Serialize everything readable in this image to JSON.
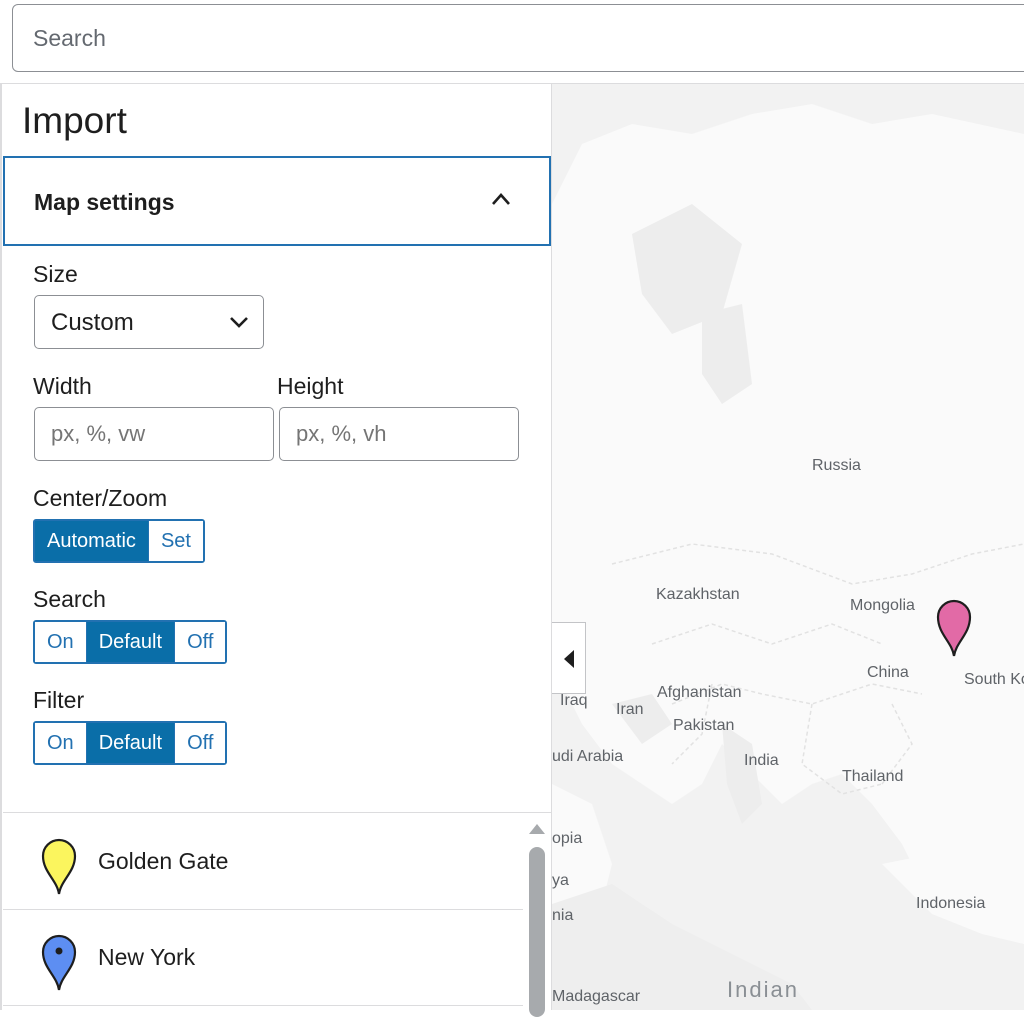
{
  "search": {
    "placeholder": "Search"
  },
  "panel": {
    "title": "Import",
    "section": {
      "label": "Map settings",
      "icon": "chevron-up-icon"
    },
    "size": {
      "label": "Size",
      "selected": "Custom",
      "icon": "chevron-down-icon"
    },
    "width": {
      "label": "Width",
      "placeholder": "px, %, vw"
    },
    "height": {
      "label": "Height",
      "placeholder": "px, %, vh"
    },
    "center_zoom": {
      "label": "Center/Zoom",
      "options": [
        "Automatic",
        "Set"
      ],
      "active": "Automatic"
    },
    "search_opt": {
      "label": "Search",
      "options": [
        "On",
        "Default",
        "Off"
      ],
      "active": "Default"
    },
    "filter_opt": {
      "label": "Filter",
      "options": [
        "On",
        "Default",
        "Off"
      ],
      "active": "Default"
    }
  },
  "pois": [
    {
      "name": "Golden Gate",
      "pin_color": "#fbf55e",
      "icon": "yellow-pin-icon"
    },
    {
      "name": "New York",
      "pin_color": "#5d8ef2",
      "icon": "blue-pin-icon"
    }
  ],
  "map": {
    "labels": {
      "russia": "Russia",
      "kazakhstan": "Kazakhstan",
      "mongolia": "Mongolia",
      "china": "China",
      "south_korea": "South Ko",
      "iraq": "Iraq",
      "iran": "Iran",
      "afghanistan": "Afghanistan",
      "pakistan": "Pakistan",
      "saudi_arabia": "udi Arabia",
      "india": "India",
      "thailand": "Thailand",
      "ethiopia": "opia",
      "kenya": "ya",
      "tanzania": "nia",
      "indonesia": "Indonesia",
      "madagascar": "Madagascar",
      "indian_ocean": "Indian"
    },
    "marker_color": "#e26aa6",
    "collapse_icon": "caret-left-icon"
  },
  "colors": {
    "accent": "#2271b1",
    "active_segment": "#0a6ea8"
  }
}
